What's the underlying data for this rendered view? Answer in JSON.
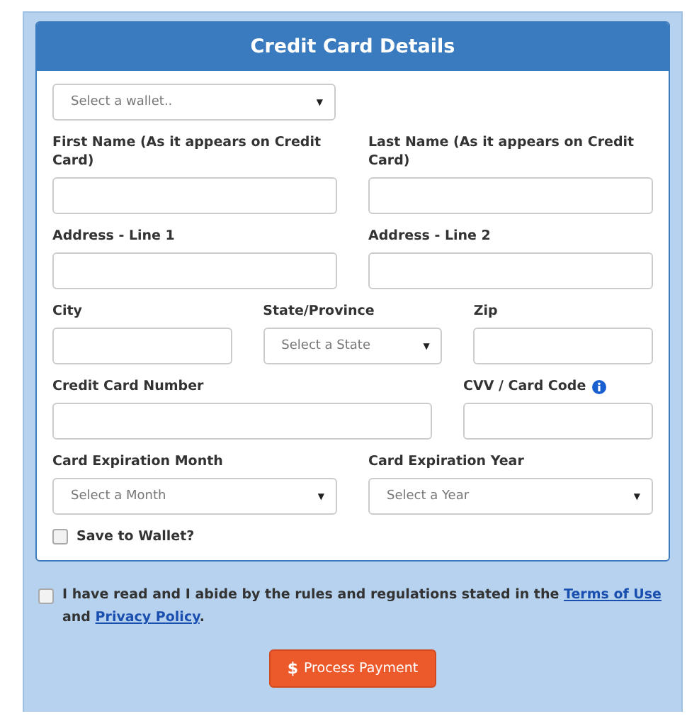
{
  "panel": {
    "title": "Credit Card Details"
  },
  "wallet": {
    "placeholder": "Select a wallet..",
    "caret": "▼"
  },
  "rows": [
    {
      "kind": "halves",
      "fields": [
        {
          "label": "First Name (As it appears on Credit Card)",
          "kind": "text"
        },
        {
          "label": "Last Name (As it appears on Credit Card)",
          "kind": "text"
        }
      ]
    },
    {
      "kind": "halves",
      "fields": [
        {
          "label": "Address - Line 1",
          "kind": "text"
        },
        {
          "label": "Address - Line 2",
          "kind": "text"
        }
      ]
    },
    {
      "kind": "thirds",
      "fields": [
        {
          "label": "City",
          "kind": "text"
        },
        {
          "label": "State/Province",
          "kind": "select",
          "placeholder": "Select a State",
          "caret": "▼"
        },
        {
          "label": "Zip",
          "kind": "text"
        }
      ]
    },
    {
      "kind": "wide",
      "fields": [
        {
          "label": "Credit Card Number",
          "kind": "text"
        },
        {
          "label": "CVV / Card Code",
          "kind": "text",
          "info": true
        }
      ]
    },
    {
      "kind": "halves",
      "fields": [
        {
          "label": "Card Expiration Month",
          "kind": "select",
          "placeholder": "Select a Month",
          "caret": "▼"
        },
        {
          "label": "Card Expiration Year",
          "kind": "select",
          "placeholder": "Select a Year",
          "caret": "▼"
        }
      ]
    }
  ],
  "save_to_wallet": {
    "label": "Save to Wallet?",
    "checked": false
  },
  "agreement": {
    "checked": false,
    "parts": [
      {
        "kind": "text",
        "text": "I have read and I abide by the rules and regulations stated in the"
      },
      {
        "kind": "link",
        "text": "Terms of Use"
      },
      {
        "kind": "text",
        "text": "and"
      },
      {
        "kind": "link",
        "text": "Privacy Policy"
      },
      {
        "kind": "text",
        "text": "."
      }
    ]
  },
  "submit": {
    "icon": "$",
    "label": "Process Payment"
  }
}
